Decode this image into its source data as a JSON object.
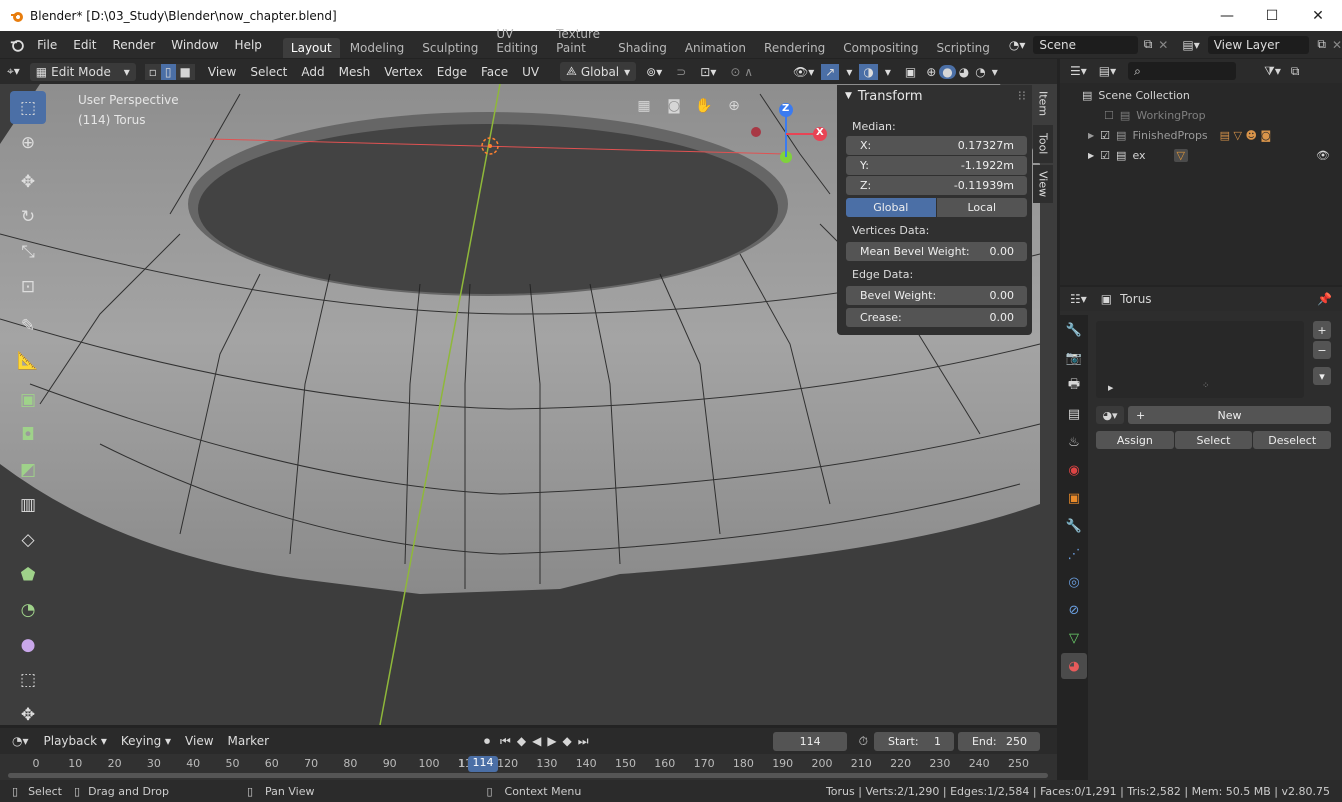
{
  "window": {
    "title": "Blender* [D:\\03_Study\\Blender\\now_chapter.blend]",
    "minimize": "—",
    "maximize": "☐",
    "close": "✕"
  },
  "menu": [
    "File",
    "Edit",
    "Render",
    "Window",
    "Help"
  ],
  "workspaces": [
    "Layout",
    "Modeling",
    "Sculpting",
    "UV Editing",
    "Texture Paint",
    "Shading",
    "Animation",
    "Rendering",
    "Compositing",
    "Scripting"
  ],
  "scene": {
    "name": "Scene",
    "view_layer": "View Layer"
  },
  "viewport_header": {
    "mode": "Edit Mode",
    "menus": [
      "View",
      "Select",
      "Add",
      "Mesh",
      "Vertex",
      "Edge",
      "Face",
      "UV"
    ],
    "orientation": "Global"
  },
  "overlay": {
    "perspective": "User Perspective",
    "object": "(114) Torus"
  },
  "gizmo": {
    "x": "X",
    "y": "Y",
    "z": "Z"
  },
  "npanel": {
    "title": "Transform",
    "median": "Median:",
    "x_label": "X:",
    "x_val": "0.17327m",
    "y_label": "Y:",
    "y_val": "-1.1922m",
    "z_label": "Z:",
    "z_val": "-0.11939m",
    "global": "Global",
    "local": "Local",
    "vertices_data": "Vertices Data:",
    "mean_bevel": "Mean Bevel Weight:",
    "mean_bevel_val": "0.00",
    "edge_data": "Edge Data:",
    "bevel_weight": "Bevel Weight:",
    "bevel_weight_val": "0.00",
    "crease": "Crease:",
    "crease_val": "0.00",
    "tabs": [
      "Item",
      "Tool",
      "View"
    ]
  },
  "outliner": {
    "root": "Scene Collection",
    "items": [
      "WorkingProp",
      "FinishedProps",
      "ex"
    ]
  },
  "properties": {
    "object": "Torus",
    "new": "New",
    "assign": "Assign",
    "select": "Select",
    "deselect": "Deselect",
    "plus": "+",
    "minus": "−"
  },
  "timeline": {
    "menus": [
      "Playback",
      "Keying",
      "View",
      "Marker"
    ],
    "frame": "114",
    "start_label": "Start:",
    "start": "1",
    "end_label": "End:",
    "end": "250",
    "ticks": [
      "0",
      "10",
      "20",
      "30",
      "40",
      "50",
      "60",
      "70",
      "80",
      "90",
      "100",
      "1",
      "110",
      "120",
      "130",
      "140",
      "150",
      "160",
      "170",
      "180",
      "190",
      "200",
      "210",
      "220",
      "230",
      "240",
      "250"
    ],
    "current": "114"
  },
  "status": {
    "select": "Select",
    "drag": "Drag and Drop",
    "pan": "Pan View",
    "context": "Context Menu",
    "stats": "Torus | Verts:2/1,290 | Edges:1/2,584 | Faces:0/1,291 | Tris:2,582 | Mem: 50.5 MB | v2.80.75"
  }
}
